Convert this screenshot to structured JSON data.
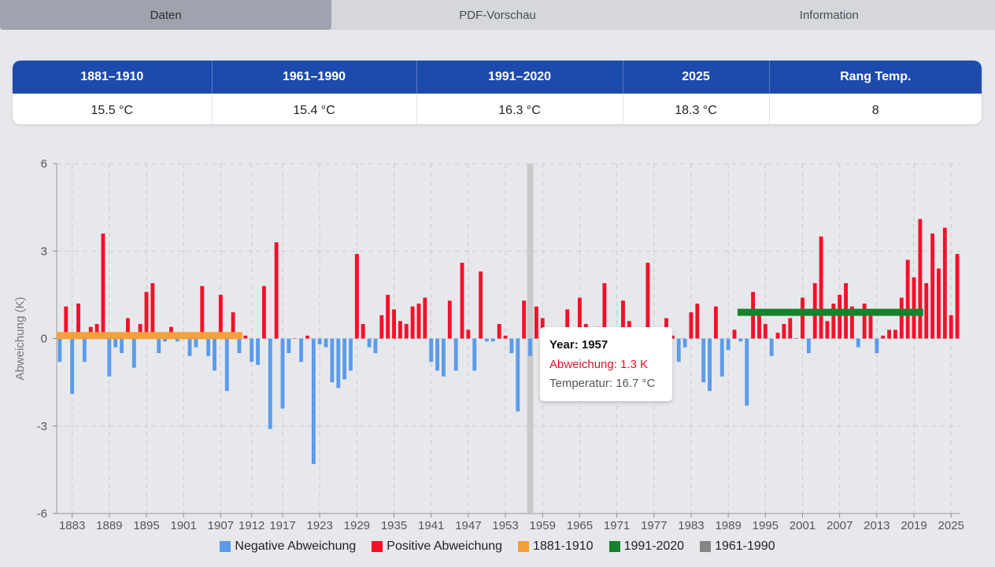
{
  "tabs": [
    {
      "label": "Daten",
      "active": true
    },
    {
      "label": "PDF-Vorschau",
      "active": false
    },
    {
      "label": "Information",
      "active": false
    }
  ],
  "summary": {
    "headers": [
      "1881–1910",
      "1961–1990",
      "1991–2020",
      "2025",
      "Rang Temp."
    ],
    "values": [
      "15.5 °C",
      "15.4 °C",
      "16.3 °C",
      "18.3 °C",
      "8"
    ]
  },
  "tooltip": {
    "year": "Year: 1957",
    "deviation": "Abweichung: 1.3 K",
    "temperature": "Temperatur: 16.7 °C"
  },
  "legend": [
    {
      "label": "Negative Abweichung",
      "color": "#5b9bea"
    },
    {
      "label": "Positive Abweichung",
      "color": "#f5102a"
    },
    {
      "label": "1881-1910",
      "color": "#f6a03a"
    },
    {
      "label": "1991-2020",
      "color": "#15832b"
    },
    {
      "label": "1961-1990",
      "color": "#858585"
    }
  ],
  "chart_data": {
    "type": "bar",
    "ylabel": "Abweichung (K)",
    "ylim": [
      -6,
      6
    ],
    "yticks": [
      6,
      3,
      0,
      -3,
      -6
    ],
    "xticks": [
      1883,
      1889,
      1895,
      1901,
      1907,
      1912,
      1917,
      1923,
      1929,
      1935,
      1941,
      1947,
      1953,
      1959,
      1965,
      1971,
      1977,
      1983,
      1989,
      1995,
      2001,
      2007,
      2013,
      2019,
      2025
    ],
    "grid": true,
    "x_start": 1881,
    "colors": {
      "negative": "#5b9bea",
      "positive": "#f5102a"
    },
    "values": [
      -0.8,
      1.1,
      -1.9,
      1.2,
      -0.8,
      0.4,
      0.5,
      3.6,
      -1.3,
      -0.3,
      -0.5,
      0.7,
      -1.0,
      0.5,
      1.6,
      1.9,
      -0.5,
      -0.1,
      0.4,
      -0.1,
      0.1,
      -0.6,
      -0.3,
      1.8,
      -0.6,
      -1.1,
      1.5,
      -1.8,
      0.9,
      -0.5,
      0.1,
      -0.8,
      -0.9,
      1.8,
      -3.1,
      3.3,
      -2.4,
      -0.5,
      0.0,
      -0.8,
      0.1,
      -4.3,
      -0.2,
      -0.3,
      -1.5,
      -1.7,
      -1.4,
      -1.1,
      2.9,
      0.5,
      -0.3,
      -0.5,
      0.8,
      1.5,
      1.0,
      0.6,
      0.5,
      1.1,
      1.2,
      1.4,
      -0.8,
      -1.1,
      -1.3,
      1.3,
      -1.1,
      2.6,
      0.3,
      -1.1,
      2.3,
      -0.1,
      -0.1,
      0.5,
      0.1,
      -0.5,
      -2.5,
      1.3,
      -0.6,
      1.1,
      0.7,
      -0.3,
      0.2,
      -0.4,
      1.0,
      0.3,
      1.4,
      0.5,
      -0.2,
      0.4,
      1.9,
      -0.4,
      0.2,
      1.3,
      0.6,
      -0.8,
      0.3,
      2.6,
      0.2,
      -0.2,
      0.7,
      0.1,
      -0.8,
      -0.3,
      0.9,
      1.2,
      -1.5,
      -1.8,
      1.1,
      -1.3,
      -0.4,
      0.3,
      -0.1,
      -2.3,
      1.6,
      0.8,
      0.5,
      -0.6,
      0.2,
      0.5,
      0.7,
      0.0,
      1.4,
      -0.5,
      1.9,
      3.5,
      0.6,
      1.2,
      1.5,
      1.9,
      1.1,
      -0.3,
      1.2,
      0.9,
      -0.5,
      0.1,
      0.3,
      0.3,
      1.4,
      2.7,
      2.1,
      4.1,
      1.9,
      3.6,
      2.4,
      3.8,
      0.8,
      2.9
    ],
    "reference_periods": [
      {
        "label": "1881-1910",
        "from": 1881,
        "to": 1910,
        "value": 0.1,
        "color": "#f6a03a"
      },
      {
        "label": "1991-2020",
        "from": 1991,
        "to": 2020,
        "value": 0.9,
        "color": "#15832b"
      }
    ],
    "highlight_year": 1957
  }
}
